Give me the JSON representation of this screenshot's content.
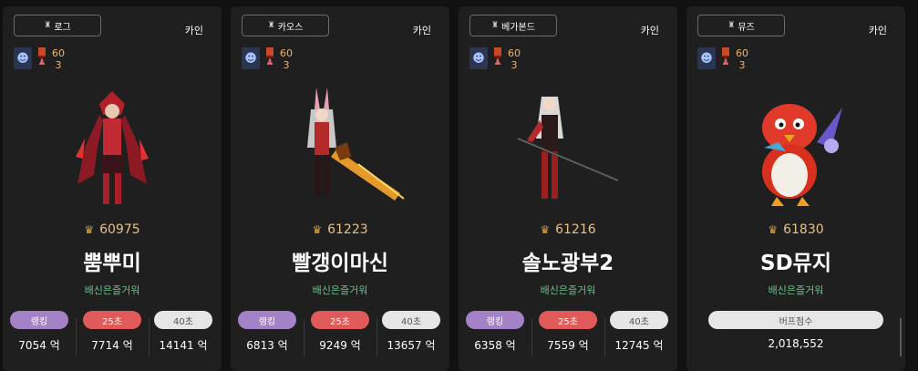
{
  "cards": [
    {
      "job": "로그",
      "server": "카인",
      "level": "60",
      "count": "3",
      "fame": "60975",
      "name": "뿜뿌미",
      "guild": "배신은즐거워",
      "stats": [
        {
          "label": "랭킹",
          "value": "7054 억"
        },
        {
          "label": "25초",
          "value": "7714 억"
        },
        {
          "label": "40초",
          "value": "14141 억"
        }
      ]
    },
    {
      "job": "카오스",
      "server": "카인",
      "level": "60",
      "count": "3",
      "fame": "61223",
      "name": "빨갱이마신",
      "guild": "배신은즐거워",
      "stats": [
        {
          "label": "랭킹",
          "value": "6813 억"
        },
        {
          "label": "25초",
          "value": "9249 억"
        },
        {
          "label": "40초",
          "value": "13657 억"
        }
      ]
    },
    {
      "job": "베가본드",
      "server": "카인",
      "level": "60",
      "count": "3",
      "fame": "61216",
      "name": "솔노광부2",
      "guild": "배신은즐거워",
      "stats": [
        {
          "label": "랭킹",
          "value": "6358 억"
        },
        {
          "label": "25초",
          "value": "7559 억"
        },
        {
          "label": "40초",
          "value": "12745 억"
        }
      ]
    },
    {
      "job": "뮤즈",
      "server": "카인",
      "level": "60",
      "count": "3",
      "fame": "61830",
      "name": "SD뮤지",
      "guild": "배신은즐거워",
      "buff": {
        "label": "버프점수",
        "value": "2,018,552"
      }
    }
  ],
  "icons": {
    "job": "character-silhouette-icon",
    "fame": "crown-icon",
    "avatar": "face-icon",
    "medal": "medal-icon"
  },
  "colors": {
    "card_bg": "#1f1f1f",
    "rank": "#a582c7",
    "s25": "#e05a5a",
    "s40": "#e6e6e6",
    "guild": "#6fbf8a",
    "fame": "#e6c089"
  }
}
